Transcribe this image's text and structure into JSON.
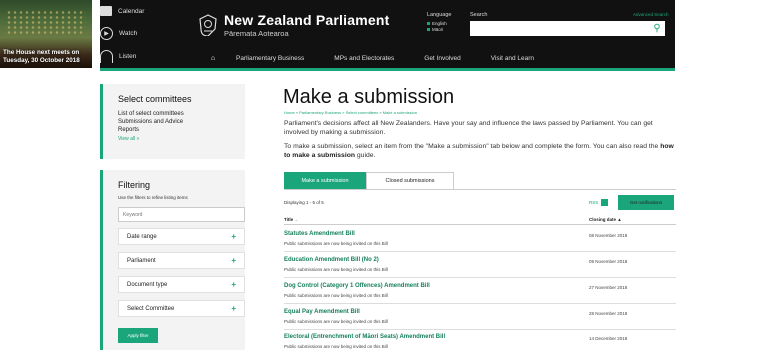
{
  "header": {
    "house_promo": "The House next meets on Tuesday, 30 October 2018",
    "links": {
      "calendar": "Calendar",
      "watch": "Watch",
      "listen": "Listen"
    },
    "site_title": "New Zealand Parliament",
    "site_subtitle": "Pāremata Aotearoa",
    "language": {
      "label": "Language",
      "options": [
        "English",
        "Māori"
      ]
    },
    "search": {
      "label": "Search",
      "advanced": "Advanced Search",
      "value": ""
    },
    "nav": [
      "Parliamentary Business",
      "MPs and Electorates",
      "Get Involved",
      "Visit and Learn"
    ],
    "accent_color": "#1aa67a"
  },
  "sidebar": {
    "select_committees": {
      "title": "Select committees",
      "links": [
        "List of select committees",
        "Submissions and Advice",
        "Reports"
      ],
      "view_all": "View all »"
    },
    "filtering": {
      "title": "Filtering",
      "help": "Use the filters to refine listing items",
      "keyword_placeholder": "Keyword",
      "filters": [
        "Date range",
        "Parliament",
        "Document type",
        "Select Committee"
      ],
      "apply_label": "Apply filter"
    }
  },
  "main": {
    "title": "Make a submission",
    "breadcrumb": "Home » Parliamentary Business » Select committees » Make a submission",
    "intro1": "Parliament's decisions affect all New Zealanders. Have your say and influence the laws passed by Parliament. You can get involved by making a submission.",
    "intro2_prefix": "To make a submission, select an item from the \"Make a submission\" tab below and complete the form. You can also read the ",
    "intro2_link": "how to make a submission",
    "intro2_suffix": " guide.",
    "tabs": [
      "Make a submission",
      "Closed submissions"
    ],
    "displaying": "Displaying 1 - 5 of 5",
    "rss": "RSS",
    "notifications_label": "Get notifications",
    "columns": {
      "title": "Title",
      "title_sort": "⌄",
      "closing": "Closing date",
      "closing_sort": "▲"
    },
    "bills": [
      {
        "title": "Statutes Amendment Bill",
        "desc": "Public submissions are now being invited on this Bill",
        "date": "08 November 2018"
      },
      {
        "title": "Education Amendment Bill (No 2)",
        "desc": "Public submissions are now being invited on this Bill",
        "date": "09 November 2018"
      },
      {
        "title": "Dog Control (Category 1 Offences) Amendment Bill",
        "desc": "Public submissions are now being invited on this Bill",
        "date": "27 November 2018"
      },
      {
        "title": "Equal Pay Amendment Bill",
        "desc": "Public submissions are now being invited on this Bill",
        "date": "28 November 2018"
      },
      {
        "title": "Electoral (Entrenchment of Māori Seats) Amendment Bill",
        "desc": "Public submissions are now being invited on this Bill",
        "date": "14 December 2018"
      }
    ]
  }
}
